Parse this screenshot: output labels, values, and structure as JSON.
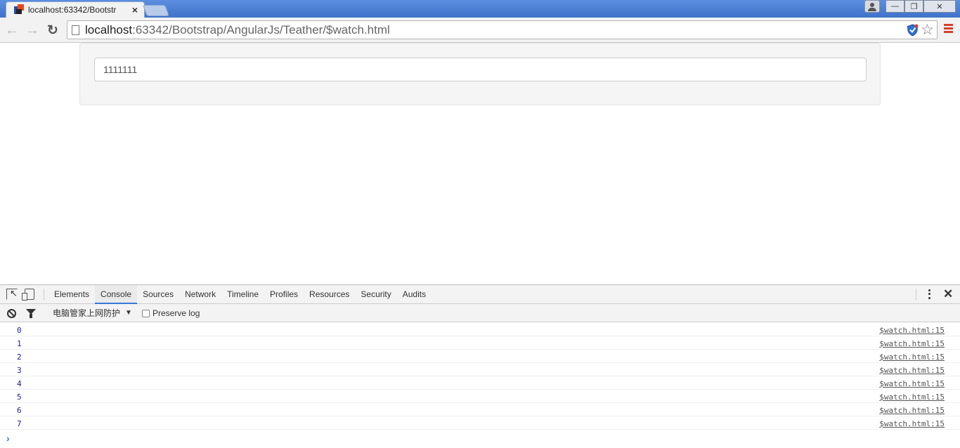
{
  "browser": {
    "tab_title": "localhost:63342/Bootstr",
    "tab_close": "×",
    "url_host": "localhost",
    "url_path": ":63342/Bootstrap/AngularJs/Teather/$watch.html",
    "window_controls": [
      "—",
      "❐",
      "✕"
    ],
    "icons": {
      "back": "back-arrow-icon",
      "forward": "forward-arrow-icon",
      "reload": "reload-icon",
      "page": "page-icon",
      "shield": "shield-icon",
      "star": "star-icon",
      "menu": "hamburger-menu-icon"
    }
  },
  "page": {
    "input_value": "1111111"
  },
  "devtools": {
    "tabs": [
      "Elements",
      "Console",
      "Sources",
      "Network",
      "Timeline",
      "Profiles",
      "Resources",
      "Security",
      "Audits"
    ],
    "active_tab": "Console",
    "context_label": "电脑管家上网防护",
    "preserve_log_label": "Preserve log",
    "close_label": "✕",
    "console_logs": [
      {
        "value": "0",
        "source": "$watch.html:15"
      },
      {
        "value": "1",
        "source": "$watch.html:15"
      },
      {
        "value": "2",
        "source": "$watch.html:15"
      },
      {
        "value": "3",
        "source": "$watch.html:15"
      },
      {
        "value": "4",
        "source": "$watch.html:15"
      },
      {
        "value": "5",
        "source": "$watch.html:15"
      },
      {
        "value": "6",
        "source": "$watch.html:15"
      },
      {
        "value": "7",
        "source": "$watch.html:15"
      }
    ],
    "prompt_symbol": "›"
  },
  "colors": {
    "title_bar": "#4b7fd6",
    "active_tab_underline": "#3879d9",
    "console_value": "#1a1aa6",
    "menu_icon": "#d6402b"
  }
}
